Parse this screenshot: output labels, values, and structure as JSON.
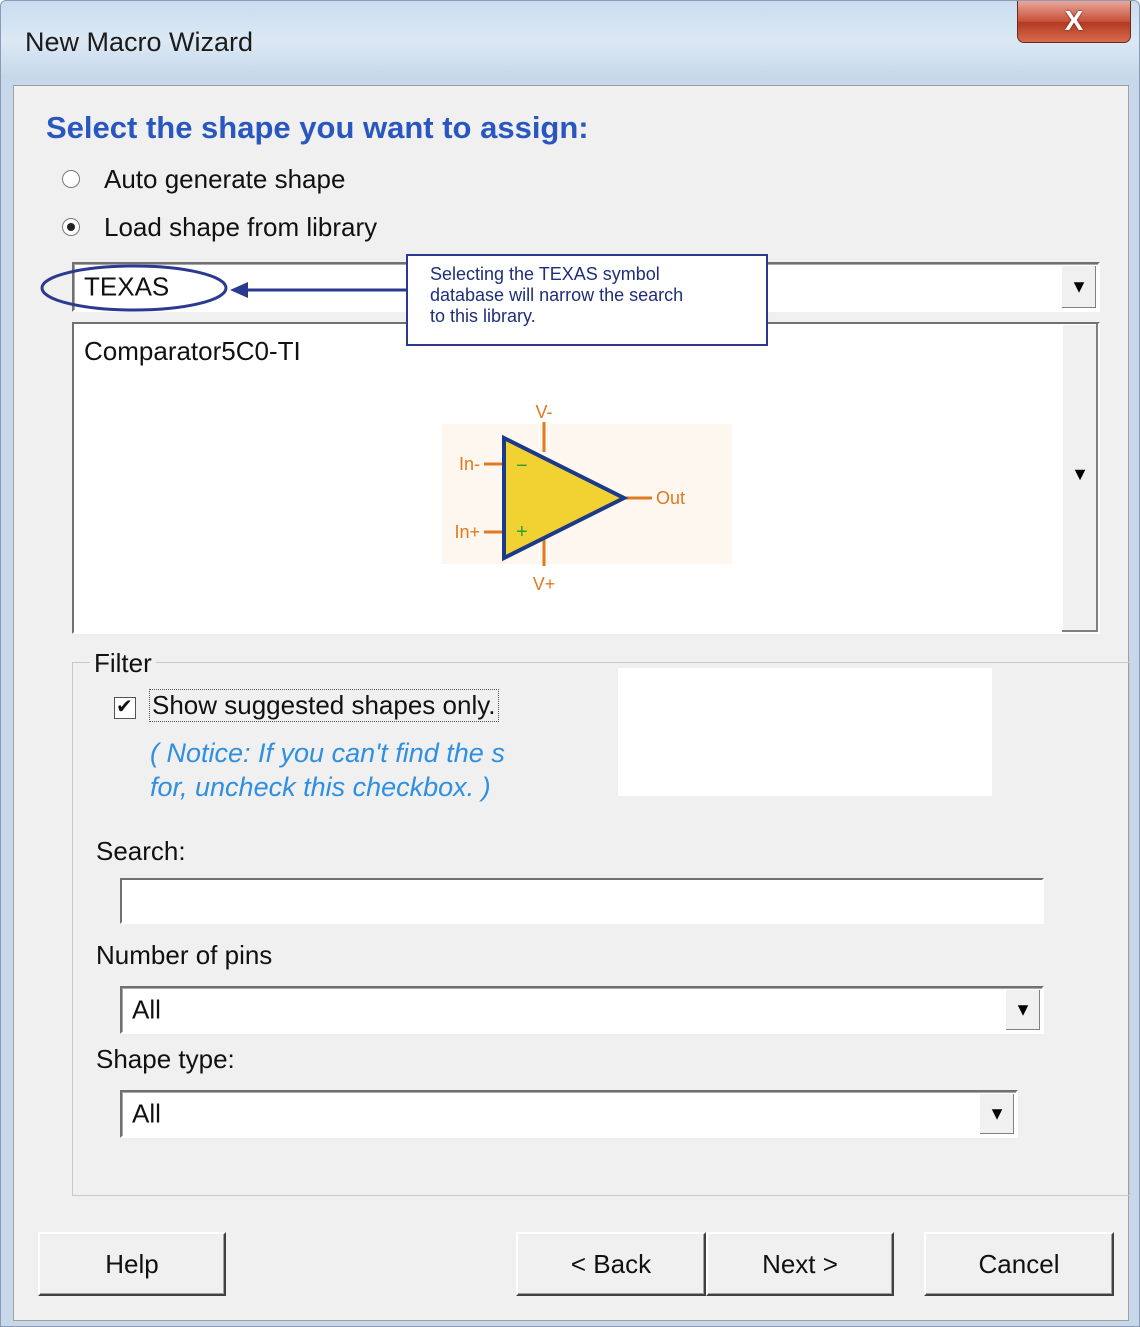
{
  "window": {
    "title": "New Macro Wizard",
    "close_glyph": "X"
  },
  "heading": "Select the shape you want to assign:",
  "options": {
    "auto_generate": "Auto generate shape",
    "load_from_library": "Load shape from library",
    "selected": "load_from_library"
  },
  "library": {
    "value": "TEXAS"
  },
  "callout": {
    "line1": "Selecting the TEXAS symbol",
    "line2": "database will narrow the search",
    "line3": "to this library."
  },
  "shape_list": {
    "selected_item": "Comparator5C0-TI",
    "symbol": {
      "pin_top": "V-",
      "pin_bottom": "V+",
      "pin_in_minus": "In-",
      "pin_in_plus": "In+",
      "pin_out": "Out",
      "minus_sign": "−",
      "plus_sign": "+"
    }
  },
  "filter": {
    "title": "Filter",
    "show_suggested_label": "Show suggested shapes only.",
    "show_suggested_checked": true,
    "notice_line1": "( Notice: If you can't find the s",
    "notice_line2": "for, uncheck this checkbox. )",
    "search_label": "Search:",
    "search_value": "",
    "pins_label": "Number of pins",
    "pins_value": "All",
    "shape_type_label": "Shape type:",
    "shape_type_value": "All"
  },
  "buttons": {
    "help": "Help",
    "back": "< Back",
    "next": "Next >",
    "cancel": "Cancel"
  },
  "colors": {
    "heading": "#2a57bf",
    "notice": "#2f8fe0",
    "annotation": "#2b3a8f",
    "symbol_fill": "#f2d233",
    "symbol_pins": "#e07a1f"
  }
}
